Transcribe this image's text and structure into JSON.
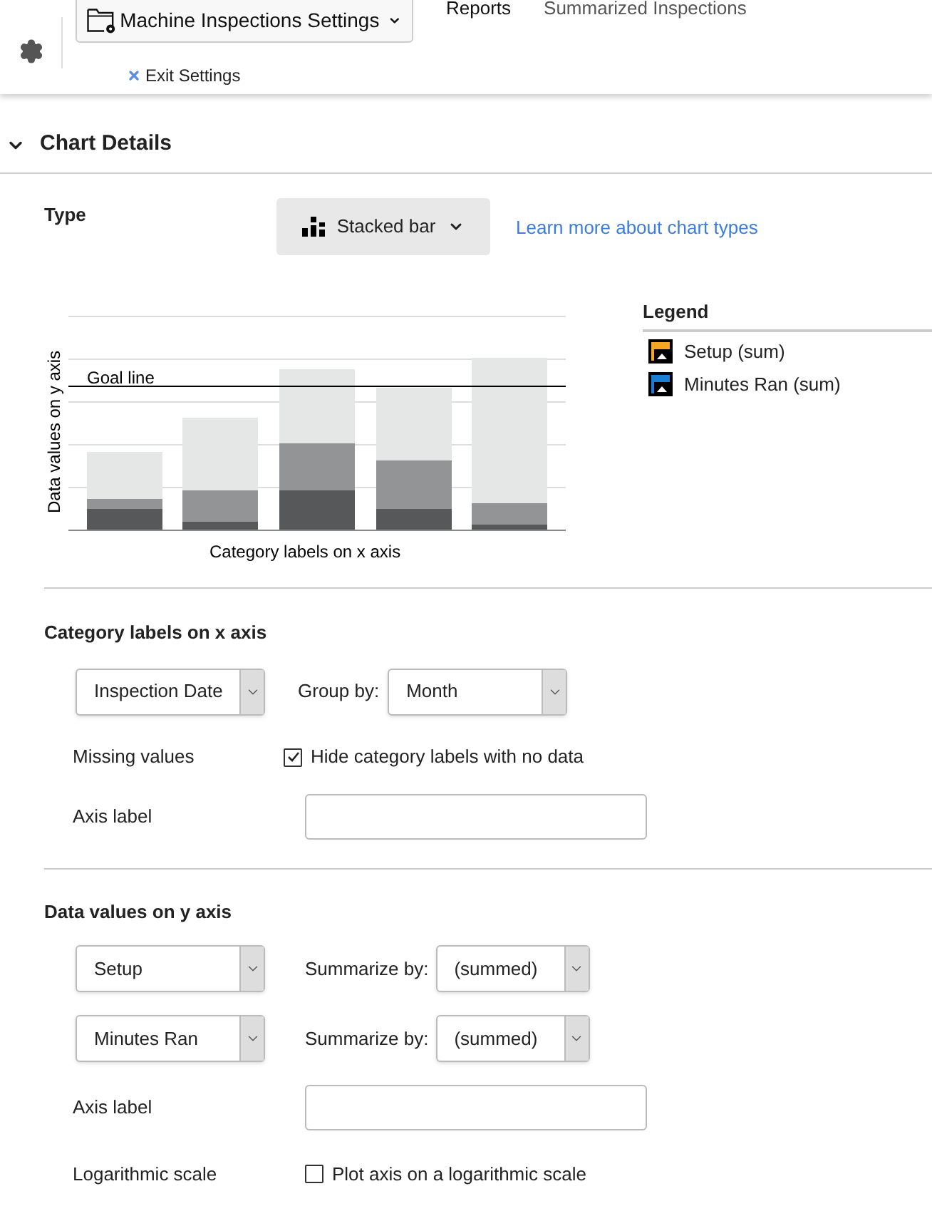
{
  "header": {
    "settings_menu": "Machine Inspections Settings",
    "exit": "Exit Settings",
    "nav": [
      {
        "label": "Reports",
        "selected": true
      },
      {
        "label": "Summarized Inspections",
        "selected": false
      }
    ]
  },
  "section": {
    "title": "Chart Details",
    "expanded": true
  },
  "type": {
    "label": "Type",
    "value": "Stacked bar",
    "link": "Learn more about chart types"
  },
  "chart_preview": {
    "y_label": "Data values on y axis",
    "goal_label": "Goal line",
    "x_label": "Category labels on x axis"
  },
  "legend": {
    "title": "Legend",
    "items": [
      {
        "label": "Setup (sum)",
        "color": "#f5a623"
      },
      {
        "label": "Minutes Ran (sum)",
        "color": "#1a7fd4"
      }
    ]
  },
  "category": {
    "title": "Category labels on x axis",
    "field": "Inspection Date",
    "group_by_label": "Group by:",
    "group_by": "Month",
    "missing": {
      "label": "Missing values",
      "checkbox_label": "Hide category labels with no data",
      "checked": true
    },
    "axis_label": "Axis label"
  },
  "values": {
    "title": "Data values on y axis",
    "series": [
      {
        "field": "Setup",
        "summarize_label": "Summarize by:",
        "summarize": "(summed)"
      },
      {
        "field": "Minutes Ran",
        "summarize_label": "Summarize by:",
        "summarize": "(summed)"
      }
    ],
    "axis_label": "Axis label",
    "log": {
      "label": "Logarithmic scale",
      "checkbox_label": "Plot axis on a logarithmic scale",
      "checked": false
    }
  }
}
